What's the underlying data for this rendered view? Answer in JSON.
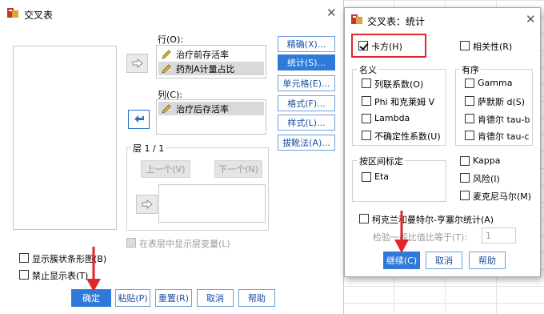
{
  "main": {
    "title": "交叉表",
    "rows_label": "行(O):",
    "rows": [
      "治疗前存活率",
      "药剂A计量占比"
    ],
    "columns_label": "列(C):",
    "columns": [
      "治疗后存活率"
    ],
    "layer_label": "层 1 / 1",
    "prev_label": "上一个(V)",
    "next_label": "下一个(N)",
    "show_layer_label": "在表层中显示层变量(L)",
    "side_buttons": [
      "精确(X)...",
      "统计(S)...",
      "单元格(E)...",
      "格式(F)...",
      "样式(L)...",
      "拔靴法(A)..."
    ],
    "check_cluster": "显示簇状条形图(B)",
    "check_suppress": "禁止显示表(T)",
    "bottom_buttons": [
      "确定",
      "粘贴(P)",
      "重置(R)",
      "取消",
      "帮助"
    ]
  },
  "stats": {
    "title": "交叉表：统计",
    "chisq": "卡方(H)",
    "correlations": "相关性(R)",
    "nominal_title": "名义",
    "nominal": [
      "列联系数(O)",
      "Phi 和克莱姆 V",
      "Lambda",
      "不确定性系数(U)"
    ],
    "ordinal_title": "有序",
    "ordinal": [
      "Gamma",
      "萨默斯 d(S)",
      "肯德尔 tau-b",
      "肯德尔 tau-c"
    ],
    "interval_title": "按区间标定",
    "interval": [
      "Eta"
    ],
    "right_checks": [
      "Kappa",
      "风险(I)",
      "麦克尼马尔(M)"
    ],
    "cmh": "柯克兰和曼特尔-亨塞尔统计(A)",
    "test_label": "检验一般比值比等于(T):",
    "test_value": "1",
    "buttons": [
      "继续(C)",
      "取消",
      "帮助"
    ]
  },
  "colors": {
    "accent": "#2f7ad8",
    "highlight": "#e0262b"
  }
}
